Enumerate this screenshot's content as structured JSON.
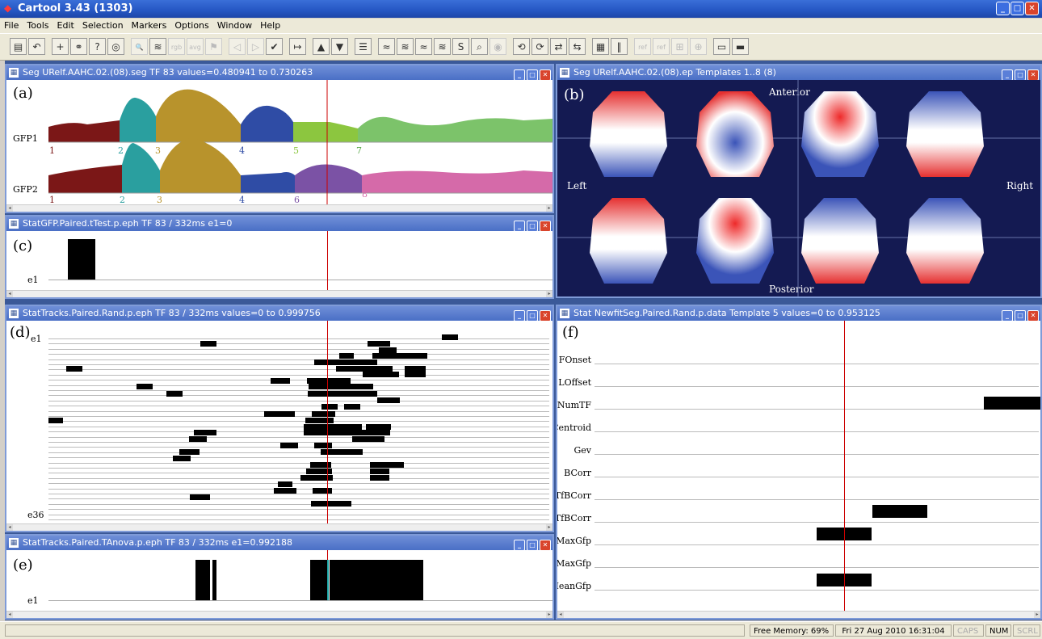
{
  "app": {
    "title": "Cartool  3.43  (1303)"
  },
  "menu": [
    "File",
    "Tools",
    "Edit",
    "Selection",
    "Markers",
    "Options",
    "Window",
    "Help"
  ],
  "toolbar_icons": [
    {
      "name": "open-doc-icon",
      "glyph": "▤",
      "enabled": true
    },
    {
      "name": "undo-icon",
      "glyph": "↶",
      "enabled": true
    },
    {
      "name": "add-icon",
      "glyph": "+",
      "enabled": true
    },
    {
      "name": "link-icon",
      "glyph": "⚭",
      "enabled": true
    },
    {
      "name": "help-icon",
      "glyph": "?",
      "enabled": true
    },
    {
      "name": "compass-icon",
      "glyph": "◎",
      "enabled": true
    },
    {
      "name": "magnify-icon",
      "glyph": "🔍",
      "enabled": false
    },
    {
      "name": "wave-icon",
      "glyph": "≋",
      "enabled": true
    },
    {
      "name": "rgb-icon",
      "glyph": "rgb",
      "enabled": false
    },
    {
      "name": "avg-icon",
      "glyph": "avg",
      "enabled": false
    },
    {
      "name": "flag-icon",
      "glyph": "⚑",
      "enabled": false
    },
    {
      "name": "prev-icon",
      "glyph": "◁",
      "enabled": false
    },
    {
      "name": "next-icon",
      "glyph": "▷",
      "enabled": false
    },
    {
      "name": "check-icon",
      "glyph": "✔",
      "enabled": true
    },
    {
      "name": "marker-icon",
      "glyph": "↦",
      "enabled": true
    },
    {
      "name": "up-icon",
      "glyph": "▲",
      "enabled": true
    },
    {
      "name": "down-icon",
      "glyph": "▼",
      "enabled": true
    },
    {
      "name": "lines-icon",
      "glyph": "☰",
      "enabled": true
    },
    {
      "name": "wave2-icon",
      "glyph": "≈",
      "enabled": true
    },
    {
      "name": "wave3-icon",
      "glyph": "≋",
      "enabled": true
    },
    {
      "name": "wave4-icon",
      "glyph": "≈",
      "enabled": true
    },
    {
      "name": "wave5-icon",
      "glyph": "≋",
      "enabled": true
    },
    {
      "name": "s-wave-icon",
      "glyph": "S",
      "enabled": true
    },
    {
      "name": "search-wave-icon",
      "glyph": "⌕",
      "enabled": true
    },
    {
      "name": "eye-icon",
      "glyph": "◉",
      "enabled": false
    },
    {
      "name": "sync-icon",
      "glyph": "⟲",
      "enabled": true
    },
    {
      "name": "sync2-icon",
      "glyph": "⟳",
      "enabled": true
    },
    {
      "name": "sync3-icon",
      "glyph": "⇄",
      "enabled": true
    },
    {
      "name": "sync4-icon",
      "glyph": "⇆",
      "enabled": true
    },
    {
      "name": "grid-icon",
      "glyph": "▦",
      "enabled": true
    },
    {
      "name": "barcode-icon",
      "glyph": "‖",
      "enabled": true
    },
    {
      "name": "ref-icon",
      "glyph": "ref",
      "enabled": false
    },
    {
      "name": "ref2-icon",
      "glyph": "ref",
      "enabled": false
    },
    {
      "name": "scale-icon",
      "glyph": "⊞",
      "enabled": false
    },
    {
      "name": "scale2-icon",
      "glyph": "⊕",
      "enabled": false
    },
    {
      "name": "window-icon",
      "glyph": "▭",
      "enabled": true
    },
    {
      "name": "window2-icon",
      "glyph": "▬",
      "enabled": true
    }
  ],
  "windows": {
    "seg": {
      "title": "Seg URelf.AAHC.02.(08).seg   TF 83  values=0.480941 to 0.730263",
      "letter": "(a)",
      "rows": [
        {
          "label": "GFP1",
          "markers": [
            "1",
            "2",
            "3",
            "4",
            "5",
            "7"
          ]
        },
        {
          "label": "GFP2",
          "markers": [
            "1",
            "2",
            "3",
            "4",
            "6",
            "8"
          ]
        }
      ]
    },
    "maps": {
      "title": "Seg URelf.AAHC.02.(08).ep   Templates 1..8 (8)",
      "letter": "(b)",
      "anterior": "Anterior",
      "posterior": "Posterior",
      "left": "Left",
      "right": "Right"
    },
    "ttest": {
      "title": "StatGFP.Paired.tTest.p.eph   TF 83 / 332ms   e1=0",
      "letter": "(c)",
      "row_label": "e1"
    },
    "tracks": {
      "title": "StatTracks.Paired.Rand.p.eph   TF 83 / 332ms   values=0 to 0.999756",
      "letter": "(d)",
      "first_label": "e1",
      "last_label": "e36"
    },
    "tanova": {
      "title": "StatTracks.Paired.TAnova.p.eph   TF 83 / 332ms   e1=0.992188",
      "letter": "(e)",
      "row_label": "e1"
    },
    "fitting": {
      "title": "Stat NewfitSeg.Paired.Rand.p.data   Template 5  values=0 to 0.953125",
      "letter": "(f)",
      "rows": [
        "FOnset",
        "LOffset",
        "NumTF",
        "Centroid",
        "Gev",
        "BCorr",
        "TfBCorr",
        "TfBCorr",
        "MaxGfp",
        "MaxGfp",
        "MeanGfp"
      ]
    }
  },
  "status": {
    "memory": "Free Memory: 69%",
    "datetime": "Fri 27 Aug 2010  16:31:04",
    "caps": "CAPS",
    "num": "NUM",
    "scrl": "SCRL"
  }
}
